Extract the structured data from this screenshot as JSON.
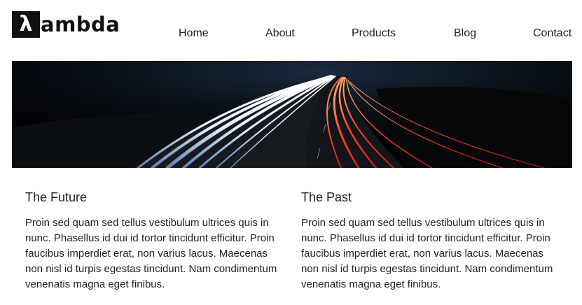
{
  "brand": {
    "logo_symbol": "λ",
    "logo_text": "ambda"
  },
  "nav": {
    "items": [
      {
        "label": "Home"
      },
      {
        "label": "About"
      },
      {
        "label": "Products"
      },
      {
        "label": "Blog"
      },
      {
        "label": "Contact"
      }
    ]
  },
  "hero": {
    "image": "highway-light-trails-night"
  },
  "sections": [
    {
      "title": "The Future",
      "body": "Proin sed quam sed tellus vestibulum ultrices quis in nunc. Phasellus id dui id tortor tincidunt efficitur. Proin faucibus imperdiet erat, non varius lacus. Maecenas non nisl id turpis egestas tincidunt. Nam condimentum venenatis magna eget finibus."
    },
    {
      "title": "The Past",
      "body": "Proin sed quam sed tellus vestibulum ultrices quis in nunc. Phasellus id dui id tortor tincidunt efficitur. Proin faucibus imperdiet erat, non varius lacus. Maecenas non nisl id turpis egestas tincidunt. Nam condimentum venenatis magna eget finibus."
    }
  ],
  "colors": {
    "text": "#222222",
    "logo_bg": "#111111",
    "hero_bg": "#05070b",
    "trail_white": "#e8eef7",
    "trail_red": "#ff3b1f"
  }
}
